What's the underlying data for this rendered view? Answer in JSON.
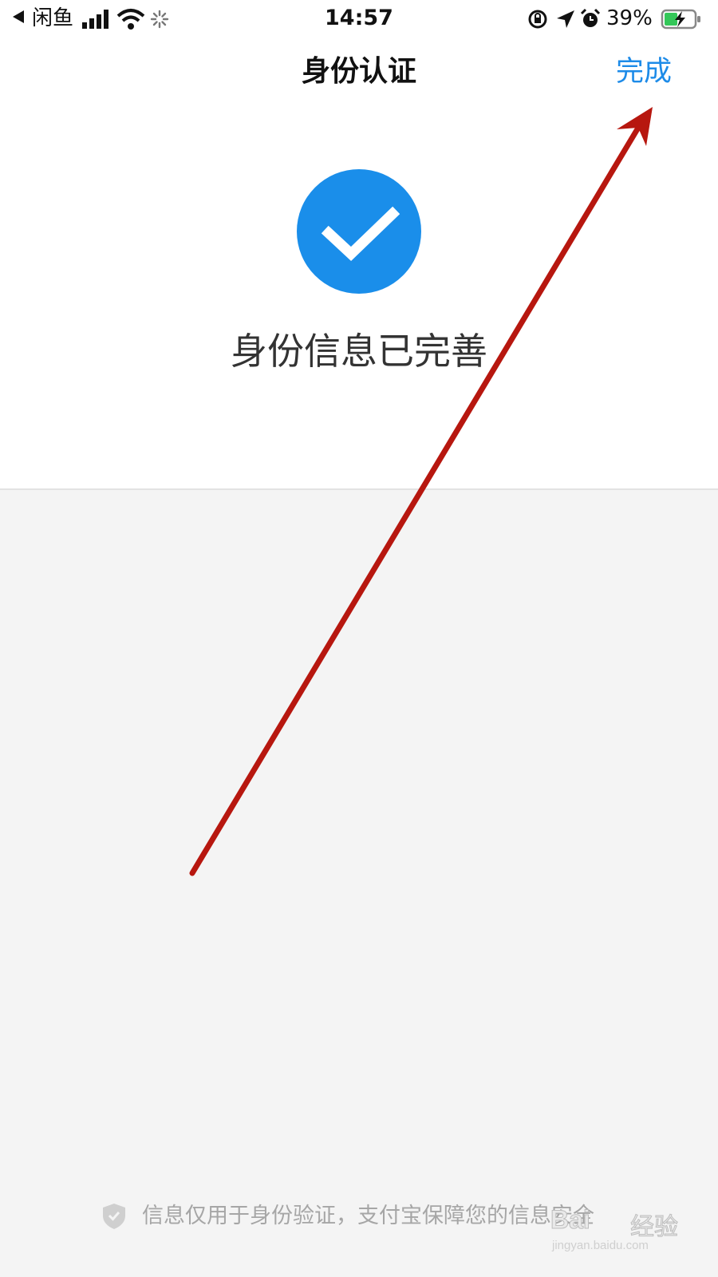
{
  "status_bar": {
    "back_app": "闲鱼",
    "time": "14:57",
    "battery": "39%"
  },
  "navbar": {
    "title": "身份认证",
    "done_label": "完成"
  },
  "result": {
    "message": "身份信息已完善"
  },
  "footer": {
    "text": "信息仅用于身份验证，支付宝保障您的信息安全"
  },
  "watermark": {
    "brand": "Bai",
    "cn": "经验",
    "url": "jingyan.baidu.com"
  },
  "colors": {
    "accent": "#1d8be8",
    "success_circle": "#1a8eea",
    "annotation_arrow": "#b7170f",
    "battery_charge": "#34c759"
  },
  "icons": [
    "back-triangle-icon",
    "signal-icon",
    "wifi-icon",
    "loading-icon",
    "rotation-lock-icon",
    "location-icon",
    "alarm-icon",
    "battery-icon",
    "check-circle-icon",
    "shield-icon"
  ]
}
